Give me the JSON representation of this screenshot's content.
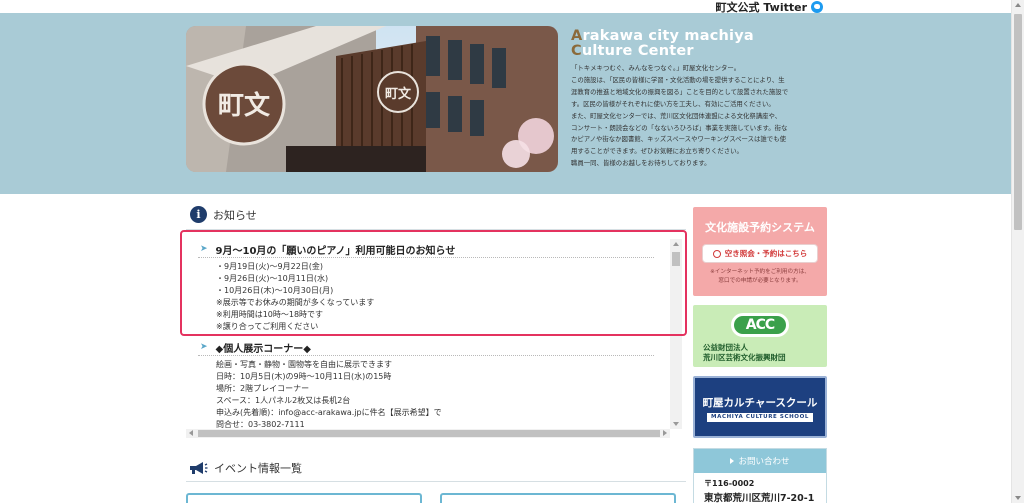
{
  "header": {
    "twitter_label": "町文公式 Twitter"
  },
  "hero": {
    "title_line1_cap": "A",
    "title_line1_rest": "rakawa city machiya",
    "title_line2_cap": "C",
    "title_line2_rest": "ulture Center",
    "description": [
      "「トキメキつむぐ、みんなをつなぐ。」町屋文化センター。",
      "この施設は、「区民の皆様に学習・文化活動の場を提供することにより、生",
      "涯教育の推進と地域文化の振興を図る」ことを目的として設置された施設で",
      "す。区民の皆様がそれぞれに使い方を工夫し、有効にご活用ください。",
      "また、町屋文化センターでは、荒川区文化団体連盟による文化祭講座や、",
      "コンサート・朗読会などの「なないろひろば」事業を実施しています。街な",
      "かピアノや街なか図書館、キッズスペースやワーキングスペースは誰でも使",
      "用することができます。ぜひお気軽にお立ち寄りください。",
      "職員一同、皆様のお越しをお待ちしております。"
    ],
    "photo_sign": "町文"
  },
  "notices": {
    "heading": "お知らせ",
    "info_glyph": "i",
    "items": [
      {
        "title": "9月～10月の「願いのピアノ」利用可能日のお知らせ",
        "lines": [
          "・9月19日(火)～9月22日(金)",
          "・9月26日(火)～10月11日(水)",
          "・10月26日(木)～10月30日(月)",
          "※展示等でお休みの期間が多くなっています",
          "※利用時間は10時～18時です",
          "※譲り合ってご利用ください"
        ]
      },
      {
        "title": "◆個人展示コーナー◆",
        "lines": [
          "絵画・写真・静物・園物等を自由に展示できます",
          "日時：10月5日(木)の9時～10月11日(水)の15時",
          "場所：2階プレイコーナー",
          "スペース：1人パネル2枚又は長机2台",
          "申込み(先着順)：info@acc-arakawa.jpに件名【展示希望】で",
          "問合せ：03-3802-7111"
        ]
      }
    ]
  },
  "events": {
    "heading": "イベント情報一覧"
  },
  "sidebar": {
    "reserve": {
      "title": "文化施設予約システム",
      "button": "空き照会・予約はこちら",
      "note_line1": "※インターネット予約をご利用の方は、",
      "note_line2": "窓口での申請が必要となります。"
    },
    "acc": {
      "logo": "ACC",
      "org_line1": "公益財団法人",
      "org_line2": "荒川区芸術文化振興財団"
    },
    "school": {
      "title": "町屋カルチャースクール",
      "subtitle": "MACHIYA CULTURE SCHOOL"
    },
    "contact": {
      "heading": "お問い合わせ",
      "postal": "〒116-0002",
      "address": "東京都荒川区荒川7-20-1"
    }
  },
  "colors": {
    "hero_bg": "#a9cbd6",
    "highlight": "#e4325f",
    "reserve_bg": "#f4a9a9",
    "acc_bg": "#c9ecb7",
    "school_bg": "#1d4080",
    "contact_header": "#8ec7d9"
  }
}
